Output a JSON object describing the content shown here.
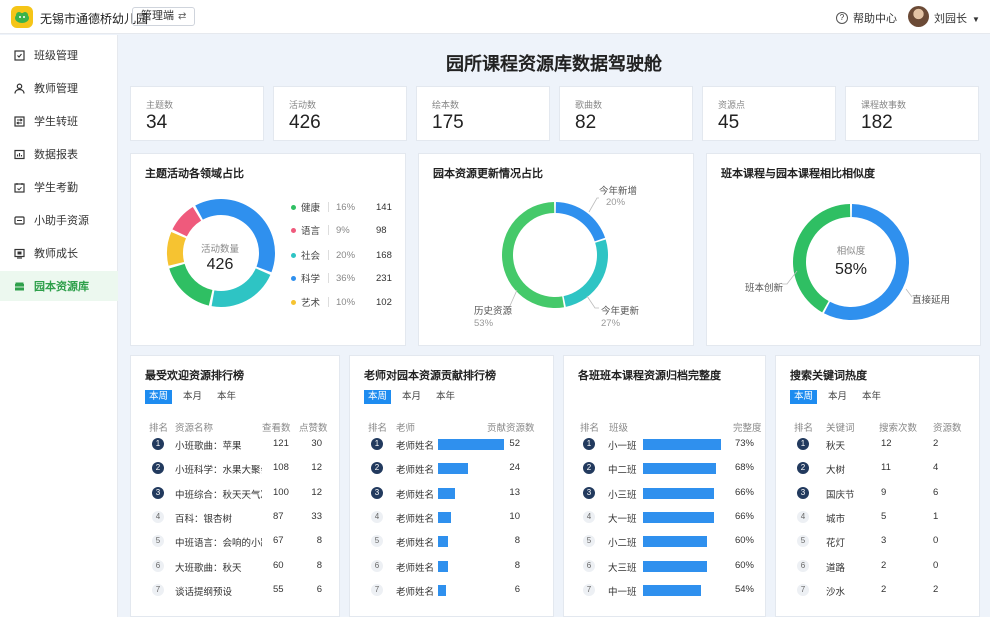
{
  "header": {
    "school_name": "无锡市通德桥幼儿园",
    "mode_label": "管理端",
    "switch_icon": "⇄",
    "help_label": "帮助中心",
    "user_name": "刘园长"
  },
  "sidebar": {
    "items": [
      {
        "label": "班级管理",
        "icon": "class-icon"
      },
      {
        "label": "教师管理",
        "icon": "teacher-icon"
      },
      {
        "label": "学生转班",
        "icon": "transfer-icon"
      },
      {
        "label": "数据报表",
        "icon": "report-icon"
      },
      {
        "label": "学生考勤",
        "icon": "attendance-icon"
      },
      {
        "label": "小助手资源",
        "icon": "assistant-icon"
      },
      {
        "label": "教师成长",
        "icon": "growth-icon"
      },
      {
        "label": "园本资源库",
        "icon": "library-icon",
        "active": true
      }
    ]
  },
  "page_title": "园所课程资源库数据驾驶舱",
  "stats": [
    {
      "label": "主题数",
      "value": "34"
    },
    {
      "label": "活动数",
      "value": "426"
    },
    {
      "label": "绘本数",
      "value": "175"
    },
    {
      "label": "歌曲数",
      "value": "82"
    },
    {
      "label": "资源点",
      "value": "45"
    },
    {
      "label": "课程故事数",
      "value": "182"
    }
  ],
  "colors": {
    "health": "#2fbf63",
    "language": "#ef5a7c",
    "social": "#2ec4c4",
    "science": "#2f90ee",
    "art": "#f6c331",
    "accent": "#1e8cf0",
    "history": "#45c96a",
    "new": "#2f90ee",
    "updated": "#2ec4c4",
    "class_created": "#2fbf63",
    "direct_use": "#2f90ee"
  },
  "chart_data": [
    {
      "type": "pie",
      "title": "主题活动各领域占比",
      "center_label": "活动数量",
      "center_value": "426",
      "slices": [
        {
          "name": "健康",
          "pct": 16,
          "value": 141,
          "color": "#2fbf63"
        },
        {
          "name": "语言",
          "pct": 9,
          "value": 98,
          "color": "#ef5a7c"
        },
        {
          "name": "社会",
          "pct": 20,
          "value": 168,
          "color": "#2ec4c4"
        },
        {
          "name": "科学",
          "pct": 36,
          "value": 231,
          "color": "#2f90ee"
        },
        {
          "name": "艺术",
          "pct": 10,
          "value": 102,
          "color": "#f6c331"
        }
      ]
    },
    {
      "type": "pie",
      "title": "园本资源更新情况占比",
      "slices": [
        {
          "name": "今年新增",
          "pct": 20,
          "color": "#2f90ee"
        },
        {
          "name": "今年更新",
          "pct": 27,
          "color": "#2ec4c4"
        },
        {
          "name": "历史资源",
          "pct": 53,
          "color": "#45c96a"
        }
      ]
    },
    {
      "type": "pie",
      "title": "班本课程与园本课程相比相似度",
      "center_label": "相似度",
      "center_value": "58%",
      "slices": [
        {
          "name": "直接延用",
          "pct": 58,
          "color": "#2f90ee"
        },
        {
          "name": "班本创新",
          "pct": 42,
          "color": "#2fbf63"
        }
      ]
    },
    {
      "type": "table",
      "title": "老师对园本资源贡献排行榜",
      "columns": [
        "排名",
        "老师",
        "贡献资源数"
      ],
      "rows": [
        {
          "name": "老师姓名",
          "value": 52
        },
        {
          "name": "老师姓名",
          "value": 24
        },
        {
          "name": "老师姓名",
          "value": 13
        },
        {
          "name": "老师姓名",
          "value": 10
        },
        {
          "name": "老师姓名",
          "value": 8
        },
        {
          "name": "老师姓名",
          "value": 8
        },
        {
          "name": "老师姓名",
          "value": 6
        }
      ],
      "max": 52
    },
    {
      "type": "table",
      "title": "各班班本课程资源归档完整度",
      "columns": [
        "排名",
        "班级",
        "完整度"
      ],
      "rows": [
        {
          "name": "小一班",
          "value": 73,
          "label": "73%"
        },
        {
          "name": "中二班",
          "value": 68,
          "label": "68%"
        },
        {
          "name": "小三班",
          "value": 66,
          "label": "66%"
        },
        {
          "name": "大一班",
          "value": 66,
          "label": "66%"
        },
        {
          "name": "小二班",
          "value": 60,
          "label": "60%"
        },
        {
          "name": "大三班",
          "value": 60,
          "label": "60%"
        },
        {
          "name": "中一班",
          "value": 54,
          "label": "54%"
        }
      ],
      "max": 73
    }
  ],
  "popular": {
    "title": "最受欢迎资源排行榜",
    "tabs": [
      "本周",
      "本月",
      "本年"
    ],
    "columns": [
      "排名",
      "资源名称",
      "查看数",
      "点赞数"
    ],
    "rows": [
      {
        "name": "小班歌曲：苹果",
        "views": "121",
        "likes": "30"
      },
      {
        "name": "小班科学：水果大聚会",
        "views": "108",
        "likes": "12"
      },
      {
        "name": "中班综合：秋天天气凉",
        "views": "100",
        "likes": "12"
      },
      {
        "name": "百科：银杏树",
        "views": "87",
        "likes": "33"
      },
      {
        "name": "中班语言：会响的小路",
        "views": "67",
        "likes": "8"
      },
      {
        "name": "大班歌曲：秋天",
        "views": "60",
        "likes": "8"
      },
      {
        "name": "谈话提纲预设",
        "views": "55",
        "likes": "6"
      }
    ]
  },
  "contrib": {
    "tabs": [
      "本周",
      "本月",
      "本年"
    ]
  },
  "keywords": {
    "title": "搜索关键词热度",
    "tabs": [
      "本周",
      "本月",
      "本年"
    ],
    "columns": [
      "排名",
      "关键词",
      "搜索次数",
      "资源数"
    ],
    "rows": [
      {
        "word": "秋天",
        "count": "12",
        "res": "2"
      },
      {
        "word": "大树",
        "count": "11",
        "res": "4"
      },
      {
        "word": "国庆节",
        "count": "9",
        "res": "6"
      },
      {
        "word": "城市",
        "count": "5",
        "res": "1"
      },
      {
        "word": "花灯",
        "count": "3",
        "res": "0"
      },
      {
        "word": "道路",
        "count": "2",
        "res": "0"
      },
      {
        "word": "沙水",
        "count": "2",
        "res": "2"
      }
    ]
  },
  "ranks": [
    "1",
    "2",
    "3",
    "4",
    "5",
    "6",
    "7"
  ]
}
